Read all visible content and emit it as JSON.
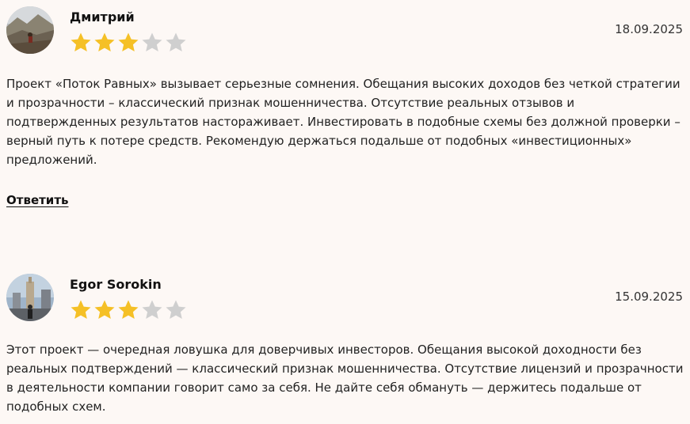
{
  "reviews": [
    {
      "author": "Дмитрий",
      "avatar_icon": "avatar-landscape-photo",
      "rating": 3,
      "rating_max": 5,
      "date": "18.09.2025",
      "text": "Проект «Поток Равных» вызывает серьезные сомнения. Обещания высоких доходов без четкой стратегии и прозрачности – классический признак мошенничества. Отсутствие реальных отзывов и подтвержденных результатов настораживает. Инвестировать в подобные схемы без должной проверки – верный путь к потере средств. Рекомендую держаться подальше от подобных «инвестиционных» предложений.",
      "reply_label": "Ответить"
    },
    {
      "author": "Egor Sorokin",
      "avatar_icon": "avatar-city-photo",
      "rating": 3,
      "rating_max": 5,
      "date": "15.09.2025",
      "text": "Этот проект — очередная ловушка для доверчивых инвесторов. Обещания высокой доходности без реальных подтверждений — классический признак мошенничества. Отсутствие лицензий и прозрачности в деятельности компании говорит само за себя. Не дайте себя обмануть — держитесь подальше от подобных схем."
    }
  ],
  "colors": {
    "background": "#fdf8f5",
    "star_filled": "#f5c026",
    "star_empty": "#cfcfcf",
    "text": "#222222"
  }
}
